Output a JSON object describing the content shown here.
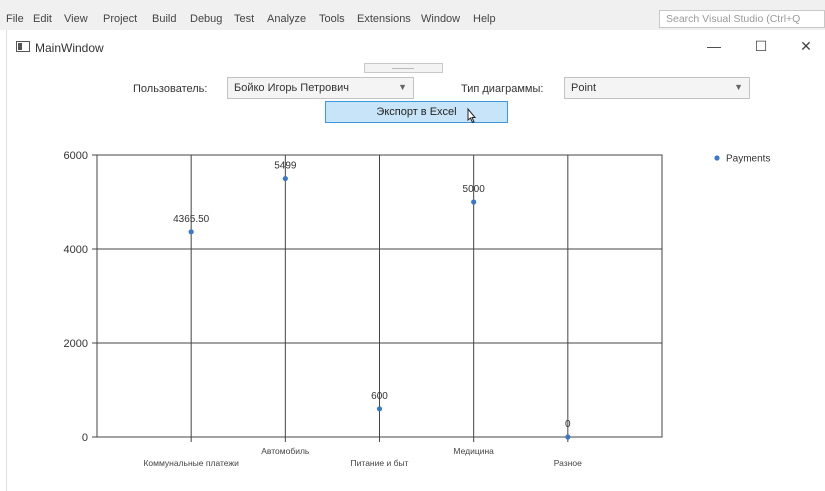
{
  "menubar": {
    "items": [
      "File",
      "Edit",
      "View",
      "Project",
      "Build",
      "Debug",
      "Test",
      "Analyze",
      "Tools",
      "Extensions",
      "Window",
      "Help"
    ],
    "search_placeholder": "Search Visual Studio (Ctrl+Q"
  },
  "window": {
    "title": "MainWindow",
    "minimize": "—",
    "maximize": "☐",
    "close": "✕"
  },
  "controls": {
    "users_label": "Пользователь:",
    "users_value": "Бойко Игорь Петрович",
    "diagram_type_label": "Тип диаграммы:",
    "diagram_type_value": "Point",
    "export_button": "Экспорт в Excel"
  },
  "colors": {
    "series": "#3a78c8",
    "grid": "#444444",
    "button_fill": "#c8e4f8",
    "button_border": "#3c98d8"
  },
  "chart_data": {
    "type": "scatter",
    "title": "",
    "xlabel": "",
    "ylabel": "",
    "categories": [
      "Коммунальные платежи",
      "Автомобиль",
      "Питание и быт",
      "Медицина",
      "Разное"
    ],
    "series": [
      {
        "name": "Payments",
        "values": [
          4365.5,
          5499,
          600,
          5000,
          0
        ]
      }
    ],
    "data_labels": [
      "4365.50",
      "5499",
      "600",
      "5000",
      "0"
    ],
    "ylim": [
      0,
      6000
    ],
    "yticks": [
      0,
      2000,
      4000,
      6000
    ],
    "grid": true,
    "legend": "top-right"
  }
}
